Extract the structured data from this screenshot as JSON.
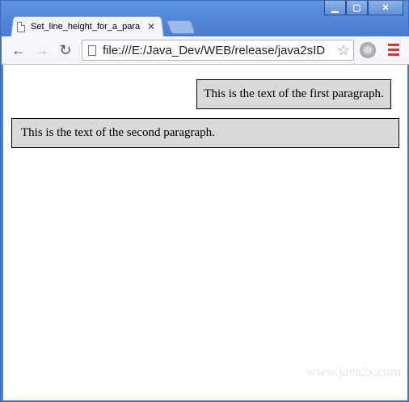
{
  "window": {
    "minimize_icon": "minimize-icon",
    "maximize_icon": "maximize-icon",
    "close_icon": "close-icon"
  },
  "tab": {
    "title": "Set_line_height_for_a_para",
    "close": "✕"
  },
  "toolbar": {
    "back": "←",
    "forward": "→",
    "reload": "↻",
    "url": "file:///E:/Java_Dev/WEB/release/java2sID",
    "star": "☆"
  },
  "content": {
    "paragraph1": "This is the text of the first paragraph.",
    "paragraph2": "This is the text of the second paragraph.",
    "watermark": "www.java2s.com"
  }
}
